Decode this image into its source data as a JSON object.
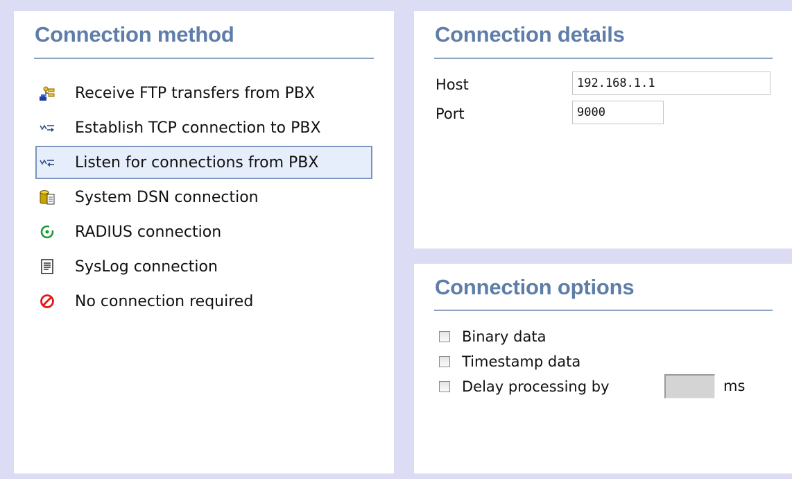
{
  "method_panel": {
    "title": "Connection method",
    "items": [
      {
        "label": "Receive FTP transfers from PBX",
        "icon": "ftp-transfer-icon",
        "selected": false
      },
      {
        "label": "Establish TCP connection to PBX",
        "icon": "tcp-outbound-icon",
        "selected": false
      },
      {
        "label": "Listen for connections from PBX",
        "icon": "tcp-listen-icon",
        "selected": true
      },
      {
        "label": "System DSN connection",
        "icon": "database-icon",
        "selected": false
      },
      {
        "label": "RADIUS connection",
        "icon": "radius-icon",
        "selected": false
      },
      {
        "label": "SysLog connection",
        "icon": "syslog-document-icon",
        "selected": false
      },
      {
        "label": "No connection required",
        "icon": "no-connection-icon",
        "selected": false
      }
    ]
  },
  "details_panel": {
    "title": "Connection details",
    "host_label": "Host",
    "host_value": "192.168.1.1",
    "port_label": "Port",
    "port_value": "9000"
  },
  "options_panel": {
    "title": "Connection options",
    "binary_label": "Binary data",
    "timestamp_label": "Timestamp data",
    "delay_label": "Delay processing by",
    "delay_value": "",
    "delay_unit": "ms"
  },
  "colors": {
    "background": "#dcdcf4",
    "title": "#5e7da8",
    "selected_fill": "#e6eefc",
    "selected_border": "#7b93bd"
  }
}
